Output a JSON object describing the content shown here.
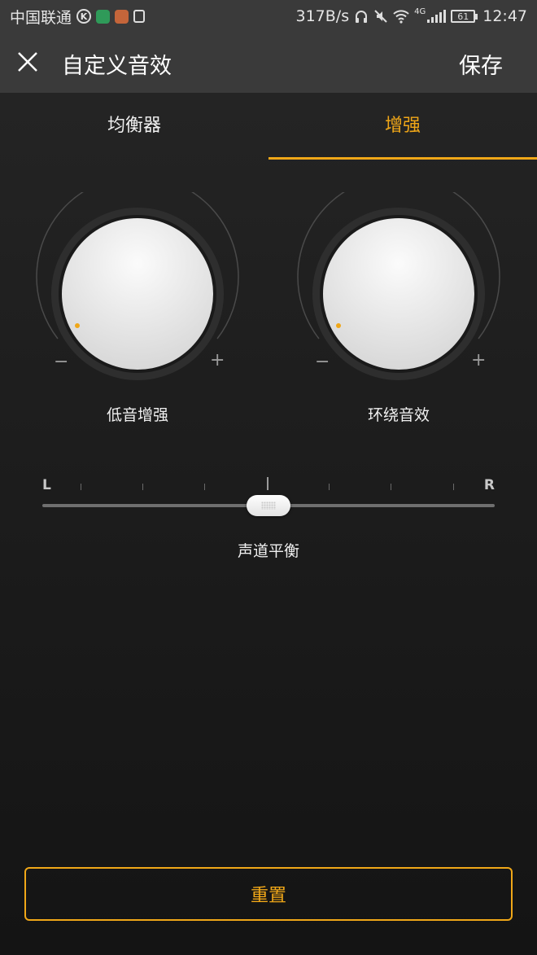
{
  "status_bar": {
    "carrier": "中国联通",
    "network_speed": "317B/s",
    "network_type": "4G",
    "battery": "61",
    "time": "12:47",
    "icons": [
      "k-app-icon",
      "wechat-icon",
      "app-icon",
      "sim-icon",
      "headphones-icon",
      "mute-icon",
      "wifi-icon",
      "signal-icon",
      "battery-icon"
    ]
  },
  "header": {
    "title": "自定义音效",
    "save_label": "保存",
    "close_icon": "close-icon"
  },
  "tabs": [
    {
      "label": "均衡器",
      "active": false
    },
    {
      "label": "增强",
      "active": true
    }
  ],
  "knobs": [
    {
      "label": "低音增强",
      "minus": "−",
      "plus": "+",
      "level": 0
    },
    {
      "label": "环绕音效",
      "minus": "−",
      "plus": "+",
      "level": 0
    }
  ],
  "balance": {
    "left_label": "L",
    "right_label": "R",
    "label": "声道平衡",
    "value": 0.5
  },
  "reset_label": "重置",
  "colors": {
    "accent": "#f0a718",
    "background": "#1c1c1c",
    "header": "#3a3a3a"
  }
}
